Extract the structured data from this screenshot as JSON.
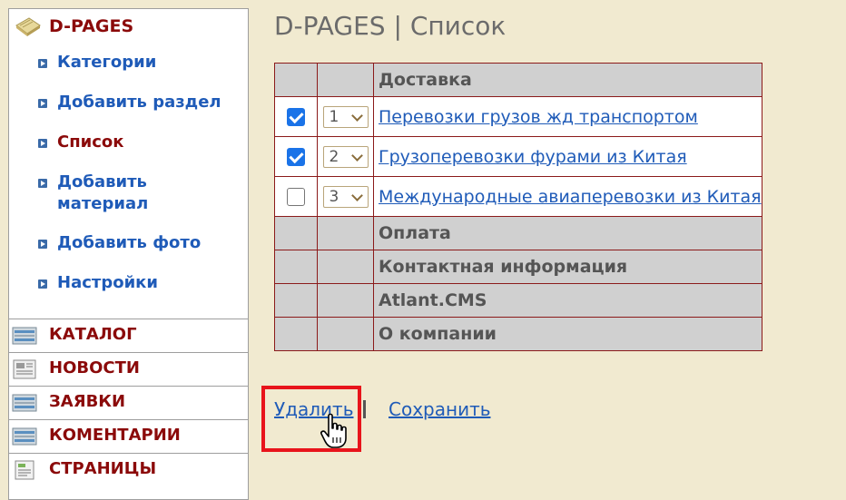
{
  "sidebar": {
    "title": "D-PAGES",
    "title_icon": "book-icon",
    "items": [
      {
        "label": "Категории",
        "active": false
      },
      {
        "label": "Добавить раздел",
        "active": false
      },
      {
        "label": "Список",
        "active": true
      },
      {
        "label": "Добавить материал",
        "active": false
      },
      {
        "label": "Добавить фото",
        "active": false
      },
      {
        "label": "Настройки",
        "active": false
      }
    ],
    "sections": [
      {
        "label": "КАТАЛОГ",
        "icon": "catalog-icon"
      },
      {
        "label": "НОВОСТИ",
        "icon": "news-icon"
      },
      {
        "label": "ЗАЯВКИ",
        "icon": "requests-icon"
      },
      {
        "label": "КОМЕНТАРИИ",
        "icon": "comments-icon"
      },
      {
        "label": "СТРАНИЦЫ",
        "icon": "pages-icon"
      }
    ]
  },
  "main": {
    "title": "D-PAGES | Список",
    "rows": [
      {
        "type": "category",
        "label": "Доставка"
      },
      {
        "type": "item",
        "checked": true,
        "order": "1",
        "label": "Перевозки грузов жд транспортом"
      },
      {
        "type": "item",
        "checked": true,
        "order": "2",
        "label": "Грузоперевозки фурами из Китая"
      },
      {
        "type": "item",
        "checked": false,
        "order": "3",
        "label": "Международные авиаперевозки из Китая"
      },
      {
        "type": "category",
        "label": "Оплата"
      },
      {
        "type": "category",
        "label": "Контактная информация"
      },
      {
        "type": "category",
        "label": "Atlant.CMS"
      },
      {
        "type": "category",
        "label": "О компании"
      }
    ],
    "actions": {
      "delete_label": "Удалить",
      "save_label": "Сохранить"
    }
  },
  "colors": {
    "background": "#f1ead0",
    "accent_red": "#8b0a0a",
    "link_blue": "#1f5bb8",
    "highlight_red": "#e8141b",
    "checkbox_blue": "#1a73e8"
  }
}
